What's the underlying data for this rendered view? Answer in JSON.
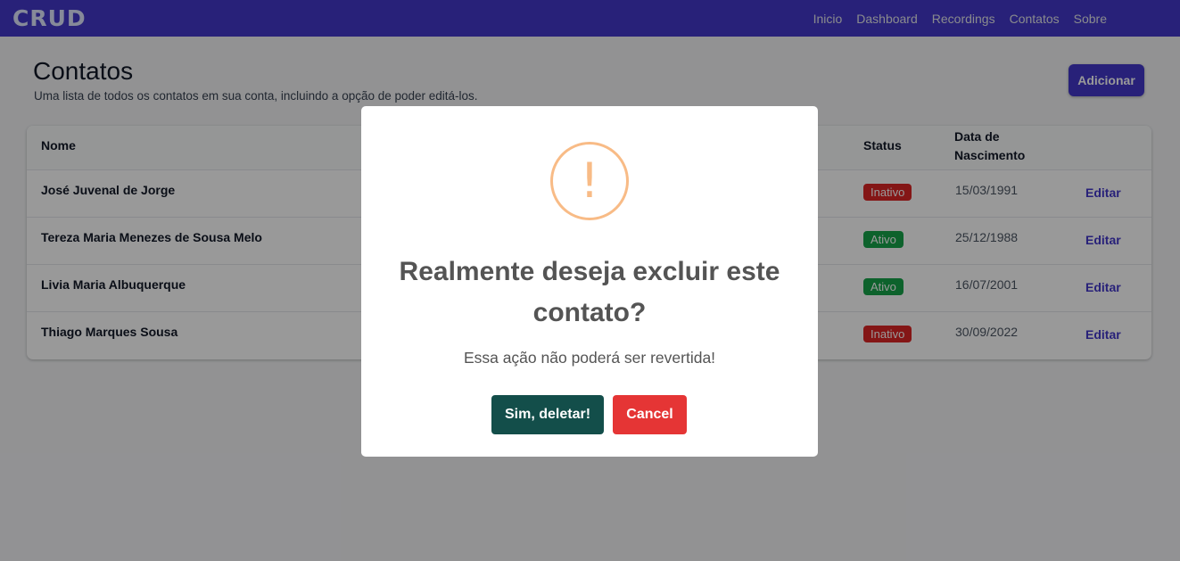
{
  "navbar": {
    "brand": "CRUD",
    "links": [
      "Inicio",
      "Dashboard",
      "Recordings",
      "Contatos",
      "Sobre"
    ]
  },
  "header": {
    "title": "Contatos",
    "subtitle": "Uma lista de todos os contatos em sua conta, incluindo a opção de poder editá-los.",
    "add_label": "Adicionar"
  },
  "table": {
    "columns": {
      "name": "Nome",
      "status": "Status",
      "birth_line1": "Data de",
      "birth_line2": "Nascimento"
    },
    "rows": [
      {
        "name": "José Juvenal de Jorge",
        "status": "Inativo",
        "birth": "15/03/1991",
        "action": "Editar"
      },
      {
        "name": "Tereza Maria Menezes de Sousa Melo",
        "status": "Ativo",
        "birth": "25/12/1988",
        "action": "Editar"
      },
      {
        "name": "Livia Maria Albuquerque",
        "status": "Ativo",
        "birth": "16/07/2001",
        "action": "Editar"
      },
      {
        "name": "Thiago Marques Sousa",
        "status": "Inativo",
        "birth": "30/09/2022",
        "action": "Editar"
      }
    ]
  },
  "modal": {
    "icon": "exclamation-icon",
    "icon_glyph": "!",
    "title": "Realmente deseja excluir este contato?",
    "text": "Essa ação não poderá ser revertida!",
    "confirm_label": "Sim, deletar!",
    "cancel_label": "Cancel"
  },
  "colors": {
    "primary": "#4338ca",
    "inactive": "#dc2626",
    "active": "#16a34a",
    "confirm": "#134e4a",
    "cancel": "#e53535",
    "warning": "#f8bb86"
  }
}
